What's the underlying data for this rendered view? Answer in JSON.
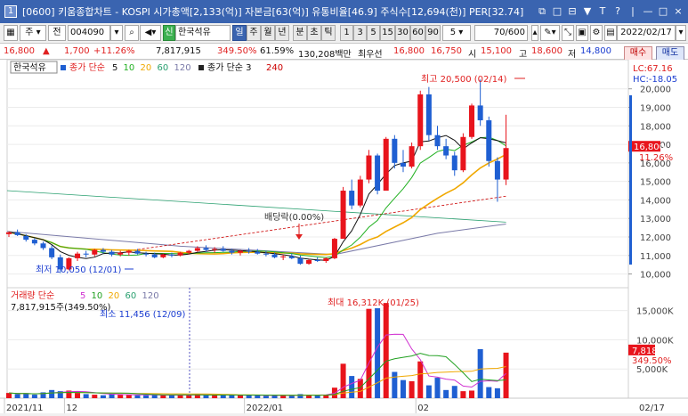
{
  "window": {
    "number": "1",
    "title": "[0600] 키움종합차트 - KOSPI 시가총액[2,133(억)] 자본금[63(억)] 유통비율[46.9] 주식수[12,694(천)] PER[32.74]",
    "controls": [
      "⧉",
      "□",
      "⊟",
      "▼",
      "T",
      "?",
      "|",
      "—",
      "□",
      "×"
    ]
  },
  "toolbar": {
    "market": "주",
    "mode": "전",
    "code": "004090",
    "name_tag": "신",
    "name": "한국석유",
    "periods": [
      "일",
      "주",
      "월",
      "년",
      "분",
      "초",
      "틱"
    ],
    "active_period": "일",
    "intervals": [
      "1",
      "3",
      "5",
      "15",
      "30",
      "60",
      "90"
    ],
    "interval_value": "5",
    "count": "70",
    "total": "/600",
    "date": "2022/02/17"
  },
  "quote": {
    "price": "16,800",
    "dir": "▲",
    "change": "1,700",
    "pct": "+11.26%",
    "volume": "7,817,915",
    "vol_ratio": "349.50%",
    "extra": "61.59%",
    "amount": "130,208백만",
    "prior_label": "최우선",
    "ask": "16,800",
    "bid": "16,750",
    "open_label": "시",
    "open": "15,100",
    "high_label": "고",
    "high": "18,600",
    "low_label": "저",
    "low": "14,800",
    "buy": "매수",
    "sell": "매도"
  },
  "chart_data": {
    "type": "candlestick",
    "dates": [
      "11/23",
      "11/24",
      "11/25",
      "11/26",
      "11/29",
      "11/30",
      "12/01",
      "12/02",
      "12/03",
      "12/06",
      "12/07",
      "12/08",
      "12/09",
      "12/10",
      "12/13",
      "12/14",
      "12/15",
      "12/16",
      "12/17",
      "12/20",
      "12/21",
      "12/22",
      "12/23",
      "12/24",
      "12/27",
      "12/28",
      "12/29",
      "12/30",
      "01/03",
      "01/04",
      "01/05",
      "01/06",
      "01/07",
      "01/10",
      "01/11",
      "01/12",
      "01/13",
      "01/14",
      "01/17",
      "01/18",
      "01/19",
      "01/20",
      "01/21",
      "01/24",
      "01/25",
      "01/26",
      "01/27",
      "01/28",
      "02/03",
      "02/04",
      "02/07",
      "02/08",
      "02/09",
      "02/10",
      "02/11",
      "02/14",
      "02/15",
      "02/16",
      "02/17"
    ],
    "ohlc": [
      [
        12150,
        12300,
        12000,
        12250
      ],
      [
        12250,
        12400,
        12050,
        12100
      ],
      [
        12050,
        12150,
        11750,
        11850
      ],
      [
        11850,
        11950,
        11550,
        11650
      ],
      [
        11650,
        11750,
        11300,
        11400
      ],
      [
        11400,
        11550,
        10800,
        10900
      ],
      [
        10900,
        11050,
        10050,
        10250
      ],
      [
        10250,
        10900,
        10200,
        10850
      ],
      [
        10850,
        11200,
        10700,
        11100
      ],
      [
        11100,
        11250,
        10900,
        11050
      ],
      [
        11050,
        11350,
        10950,
        11300
      ],
      [
        11300,
        11400,
        11100,
        11200
      ],
      [
        11200,
        11300,
        10950,
        11050
      ],
      [
        11050,
        11250,
        10950,
        11150
      ],
      [
        11150,
        11300,
        11000,
        11250
      ],
      [
        11250,
        11350,
        11050,
        11100
      ],
      [
        11100,
        11200,
        10950,
        11050
      ],
      [
        11050,
        11150,
        10850,
        10900
      ],
      [
        10900,
        11100,
        10850,
        11050
      ],
      [
        11050,
        11150,
        10900,
        11000
      ],
      [
        11000,
        11200,
        10950,
        11150
      ],
      [
        11150,
        11300,
        11050,
        11250
      ],
      [
        11250,
        11500,
        11200,
        11400
      ],
      [
        11400,
        11550,
        11200,
        11300
      ],
      [
        11300,
        11450,
        11150,
        11350
      ],
      [
        11350,
        11500,
        11200,
        11250
      ],
      [
        11250,
        11350,
        11050,
        11150
      ],
      [
        11150,
        11300,
        11000,
        11250
      ],
      [
        11250,
        11400,
        11100,
        11200
      ],
      [
        11200,
        11350,
        11050,
        11100
      ],
      [
        11100,
        11250,
        10950,
        11050
      ],
      [
        11050,
        11150,
        10850,
        10900
      ],
      [
        10900,
        11050,
        10750,
        10950
      ],
      [
        10950,
        11100,
        10800,
        10850
      ],
      [
        10850,
        11000,
        10500,
        10550
      ],
      [
        10550,
        10800,
        10500,
        10750
      ],
      [
        10750,
        10900,
        10650,
        10700
      ],
      [
        10700,
        10900,
        10600,
        10850
      ],
      [
        10850,
        11950,
        10800,
        11900
      ],
      [
        11900,
        14700,
        11900,
        14500
      ],
      [
        14500,
        15100,
        13500,
        13700
      ],
      [
        13700,
        15300,
        13600,
        15100
      ],
      [
        15100,
        16700,
        14900,
        16400
      ],
      [
        16400,
        16500,
        14300,
        14500
      ],
      [
        14500,
        17400,
        14500,
        17300
      ],
      [
        17300,
        17500,
        15700,
        16000
      ],
      [
        16000,
        16700,
        15500,
        15800
      ],
      [
        15800,
        17100,
        15700,
        16900
      ],
      [
        16900,
        19900,
        16700,
        19700
      ],
      [
        19700,
        20100,
        17200,
        17500
      ],
      [
        17500,
        18000,
        16700,
        16900
      ],
      [
        16900,
        17300,
        16200,
        16400
      ],
      [
        16400,
        16600,
        15300,
        15600
      ],
      [
        15600,
        17600,
        15500,
        17400
      ],
      [
        17400,
        19200,
        17300,
        19100
      ],
      [
        19100,
        20500,
        18000,
        18300
      ],
      [
        18300,
        18500,
        15800,
        16100
      ],
      [
        16100,
        16300,
        13900,
        15100
      ],
      [
        15100,
        18600,
        14800,
        16800
      ]
    ],
    "volume_k": [
      900,
      700,
      800,
      600,
      1000,
      1400,
      1200,
      1300,
      900,
      700,
      600,
      500,
      700,
      600,
      600,
      500,
      500,
      600,
      500,
      500,
      600,
      500,
      700,
      500,
      500,
      600,
      500,
      500,
      500,
      500,
      400,
      500,
      500,
      400,
      700,
      600,
      500,
      600,
      1800,
      5900,
      3800,
      3300,
      15300,
      15400,
      16300,
      4500,
      3100,
      2900,
      6300,
      2200,
      3500,
      1400,
      2100,
      1200,
      1300,
      8400,
      1900,
      1700,
      7800
    ],
    "y_ticks": [
      10000,
      11000,
      12000,
      13000,
      14000,
      15000,
      16000,
      17000,
      18000,
      19000,
      20000
    ],
    "y_tick_labels": [
      "10,000",
      "11,000",
      "12,000",
      "13,000",
      "14,000",
      "15,000",
      "16,000",
      "17,000",
      "18,000",
      "19,000",
      "20,000"
    ],
    "ylim": [
      9450,
      20900
    ],
    "vol_ticks": [
      5000,
      10000,
      15000
    ],
    "vol_tick_labels": [
      "5,000K",
      "10,000K",
      "15,000K"
    ],
    "vlim": [
      0,
      18000
    ],
    "x_ticks": [
      {
        "i": 0,
        "label": "2021/11"
      },
      {
        "i": 7,
        "label": "12"
      },
      {
        "i": 28,
        "label": "2022/01"
      },
      {
        "i": 48,
        "label": "02"
      }
    ],
    "x_last": "02/17",
    "legend_price": {
      "name": "한국석유",
      "ma_title": "종가 단순",
      "ma_periods": [
        "5",
        "10",
        "20",
        "60",
        "120"
      ],
      "ma_colors": [
        "#111111",
        "#20b020",
        "#f0a800",
        "#2aa070",
        "#7a7aa8"
      ],
      "third": "종가 단순 3",
      "third_period": "240",
      "third_color": "#cc0000"
    },
    "legend_volume": {
      "title": "거래량 단순",
      "periods": [
        "5",
        "10",
        "20",
        "60",
        "120"
      ],
      "colors": [
        "#d030d0",
        "#20a020",
        "#f0a800",
        "#2aa070",
        "#7a7aa8"
      ],
      "value": "7,817,915주(349.50%)"
    },
    "annotations": {
      "max_price": "최고 20,500 (02/14)",
      "min_price": "최저 10,050 (12/01)",
      "dividend": "배당락(0.00%)",
      "max_vol": "최대 16,312K (01/25)",
      "min_vol": "최소 11,456 (12/09)",
      "lc": "LC:67.16",
      "hc": "HC:-18.05",
      "price_tag": "16,800",
      "pct_tag": "11.26%",
      "vol_tag": "7,818K",
      "vol_pct_tag": "349.50%"
    },
    "up_color": "#e8141c",
    "down_color": "#1f5fd2"
  }
}
